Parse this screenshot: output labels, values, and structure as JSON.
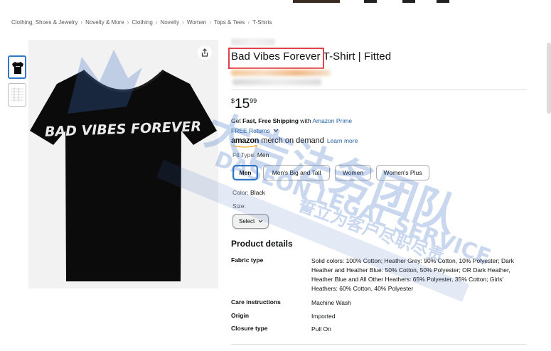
{
  "breadcrumb": [
    "Clothing, Shoes & Jewelry",
    "Novelty & More",
    "Clothing",
    "Novelty",
    "Women",
    "Tops & Tees",
    "T-Shirts"
  ],
  "breadcrumb_separator": "›",
  "product": {
    "title": "Bad Vibes Forever T-Shirt | Fitted",
    "shirt_print": "BAD VIBES FOREVER",
    "price": {
      "symbol": "$",
      "whole": "15",
      "fraction": "99"
    }
  },
  "shipping": {
    "prefix": "Get ",
    "bold": "Fast, Free Shipping",
    "mid": " with ",
    "link": "Amazon Prime"
  },
  "returns": "FREE Returns",
  "merch": {
    "brand": "amazon",
    "rest": " merch on demand",
    "learn_more": "Learn more"
  },
  "fit_type": {
    "label": "Fit Type: ",
    "value": "Men"
  },
  "fit_options": [
    "Men",
    "Men's Big and Tall",
    "Women",
    "Women's Plus"
  ],
  "fit_selected": "Men",
  "color": {
    "label": "Color: ",
    "value": "Black"
  },
  "size": {
    "label": "Size:",
    "select": "Select"
  },
  "product_details": {
    "heading": "Product details",
    "rows": [
      {
        "key": "Fabric type",
        "value": "Solid colors: 100% Cotton; Heather Grey: 90% Cotton, 10% Polyester; Dark Heather and Heather Blue: 50% Cotton, 50% Polyester; OR Dark Heather, Heather Blue and All Other Heathers: 65% Polyester, 35% Cotton; Girls' Heathers: 60% Cotton, 40% Polyester"
      },
      {
        "key": "Care instructions",
        "value": "Machine Wash"
      },
      {
        "key": "Origin",
        "value": "Imported"
      },
      {
        "key": "Closure type",
        "value": "Pull On"
      }
    ]
  },
  "watermark": {
    "line1": "大吉法务团队",
    "line2": "DASEON LEGAL SERVICE",
    "line3": "誓立为客户尽职尽责"
  },
  "colors": {
    "link": "#2162a1",
    "highlight_box": "#e0424a",
    "selected_border": "#2f76c4",
    "shirt": "#0b0b0b",
    "watermark": "#3d6fc4"
  },
  "icons": {
    "share": "share-icon",
    "chevron": "chevron-down-icon"
  }
}
